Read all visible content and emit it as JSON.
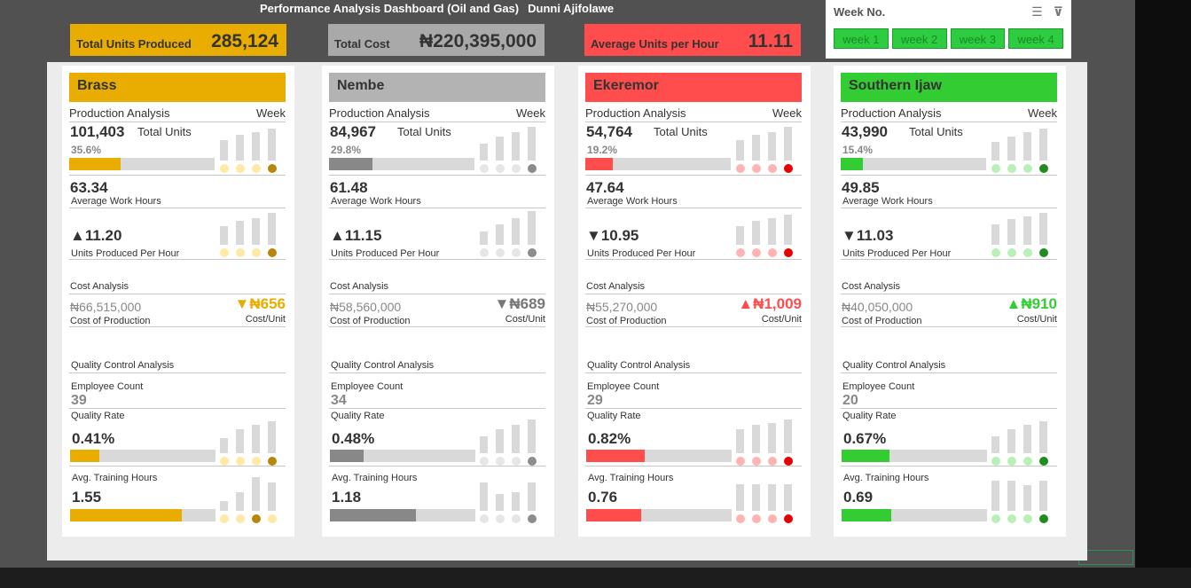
{
  "header": {
    "title": "Performance Analysis Dashboard (Oil and Gas)",
    "author": "Dunni Ajifolawe"
  },
  "kpis": [
    {
      "label": "Total Units Produced",
      "value": "285,124",
      "bg": "#e9ac00",
      "color": "#333333"
    },
    {
      "label": "Total Cost",
      "value": "₦220,395,000",
      "bg": "#a9a9a9",
      "color": "#333333"
    },
    {
      "label": "Average Units per Hour",
      "value": "11.11",
      "bg": "#ff4d4d",
      "color": "#333333"
    }
  ],
  "slicer": {
    "title": "Week No.",
    "buttons": [
      "week 1",
      "week 2",
      "week 3",
      "week 4"
    ]
  },
  "labels": {
    "production": "Production Analysis",
    "week": "Week",
    "total_units": "Total Units",
    "avg_work_hours": "Average Work Hours",
    "units_per_hour": "Units Produced Per Hour",
    "cost_analysis": "Cost Analysis",
    "cost_of_production": "Cost of Production",
    "cost_unit": "Cost/Unit",
    "quality_analysis": "Quality Control Analysis",
    "employee_count": "Employee Count",
    "quality_rate": "Quality Rate",
    "avg_training": "Avg. Training Hours"
  },
  "regions": [
    {
      "name": "Brass",
      "head_bg": "#e9ac00",
      "accent": "#e9ac00",
      "dot_light": "#ffe9a6",
      "dot_dark": "#b8860b",
      "total_units": "101,403",
      "share": "35.6%",
      "share_fill": 0.356,
      "avg_work_hours": "63.34",
      "uph_arrow": "▲",
      "uph": "11.20",
      "cost": "₦66,515,000",
      "cost_arrow": "▼",
      "cost_unit": "₦656",
      "cost_color": "#e9ac00",
      "employees": "39",
      "quality_rate": "0.41%",
      "quality_fill": 0.41,
      "training": "1.55",
      "training_fill": 0.77,
      "spark_units": [
        0.6,
        0.75,
        0.85,
        0.95
      ],
      "spark_hours": [
        0.6,
        0.7,
        0.85,
        0.95
      ],
      "spark_uph": [
        0.55,
        0.7,
        0.8,
        0.95
      ],
      "spark_quality": [
        0.45,
        0.7,
        0.85,
        0.95
      ],
      "spark_training": [
        0.3,
        0.55,
        1.0,
        0.85
      ],
      "training_dark": 2
    },
    {
      "name": "Nembe",
      "head_bg": "#b3b3b3",
      "accent": "#888888",
      "dot_light": "#e6e6e6",
      "dot_dark": "#8c8c8c",
      "total_units": "84,967",
      "share": "29.8%",
      "share_fill": 0.298,
      "avg_work_hours": "61.48",
      "uph_arrow": "▲",
      "uph": "11.15",
      "cost": "₦58,560,000",
      "cost_arrow": "▼",
      "cost_unit": "₦689",
      "cost_color": "#777777",
      "employees": "34",
      "quality_rate": "0.48%",
      "quality_fill": 0.48,
      "training": "1.18",
      "training_fill": 0.59,
      "spark_units": [
        0.5,
        0.7,
        0.85,
        1.0
      ],
      "spark_hours": [
        0.45,
        0.65,
        0.85,
        1.0
      ],
      "spark_uph": [
        0.4,
        0.6,
        0.8,
        1.0
      ],
      "spark_quality": [
        0.5,
        0.7,
        0.85,
        1.0
      ],
      "spark_training": [
        0.85,
        0.5,
        0.55,
        0.85
      ],
      "training_dark": -1
    },
    {
      "name": "Ekeremor",
      "head_bg": "#ff4d4d",
      "accent": "#ff4d4d",
      "dot_light": "#ffb3b3",
      "dot_dark": "#e60000",
      "total_units": "54,764",
      "share": "19.2%",
      "share_fill": 0.192,
      "avg_work_hours": "47.64",
      "uph_arrow": "▼",
      "uph": "10.95",
      "cost": "₦55,270,000",
      "cost_arrow": "▲",
      "cost_unit": "₦1,009",
      "cost_color": "#ff4d4d",
      "employees": "29",
      "quality_rate": "0.82%",
      "quality_fill": 0.82,
      "training": "0.76",
      "training_fill": 0.38,
      "spark_units": [
        0.6,
        0.75,
        0.85,
        1.0
      ],
      "spark_hours": [
        0.55,
        0.7,
        0.8,
        0.9
      ],
      "spark_uph": [
        0.55,
        0.7,
        0.8,
        0.9
      ],
      "spark_quality": [
        0.7,
        0.85,
        0.9,
        1.0
      ],
      "spark_training": [
        0.8,
        0.8,
        0.8,
        0.8
      ],
      "training_dark": -1
    },
    {
      "name": "Southern Ijaw",
      "head_bg": "#33cc33",
      "accent": "#33cc33",
      "dot_light": "#b8f0b8",
      "dot_dark": "#1e8c1e",
      "total_units": "43,990",
      "share": "15.4%",
      "share_fill": 0.154,
      "avg_work_hours": "49.85",
      "uph_arrow": "▼",
      "uph": "11.03",
      "cost": "₦40,050,000",
      "cost_arrow": "▲",
      "cost_unit": "₦910",
      "cost_color": "#33cc33",
      "employees": "20",
      "quality_rate": "0.67%",
      "quality_fill": 0.67,
      "training": "0.69",
      "training_fill": 0.34,
      "spark_units": [
        0.55,
        0.7,
        0.85,
        0.95
      ],
      "spark_hours": [
        0.6,
        0.75,
        0.85,
        0.95
      ],
      "spark_uph": [
        0.6,
        0.75,
        0.85,
        0.95
      ],
      "spark_quality": [
        0.5,
        0.7,
        0.85,
        0.95
      ],
      "spark_training": [
        0.9,
        0.9,
        0.75,
        0.9
      ],
      "training_dark": -1
    }
  ]
}
